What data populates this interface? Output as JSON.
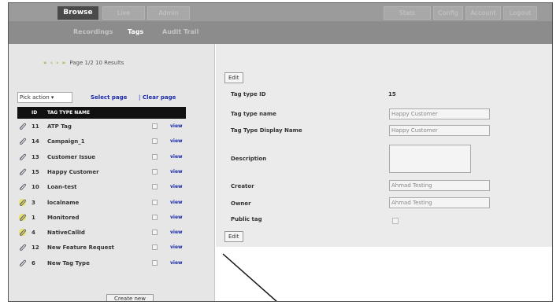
{
  "nav": {
    "tabs_left": [
      {
        "label": "Browse",
        "active": true
      },
      {
        "label": "Live",
        "active": false
      },
      {
        "label": "Admin",
        "active": false
      }
    ],
    "tabs_right": [
      {
        "label": "Stats"
      },
      {
        "label": "Config"
      },
      {
        "label": "Account"
      },
      {
        "label": "Logout"
      }
    ],
    "subtabs": [
      {
        "label": "Recordings",
        "active": false
      },
      {
        "label": "Tags",
        "active": true
      },
      {
        "label": "Audit Trail",
        "active": false
      }
    ]
  },
  "list": {
    "pager": {
      "nav_glyphs": "« ‹ › »",
      "text": "Page 1/2 10 Results"
    },
    "pick_action": "Pick action ▾",
    "select_page": "Select page",
    "separator": "|",
    "clear_page": "Clear page",
    "columns": [
      "ID",
      "TAG TYPE NAME"
    ],
    "rows": [
      {
        "id": "11",
        "name": "ATP Tag",
        "icon": "paperclip-icon",
        "view": "view"
      },
      {
        "id": "14",
        "name": "Campaign_1",
        "icon": "paperclip-icon",
        "view": "view"
      },
      {
        "id": "13",
        "name": "Customer Issue",
        "icon": "paperclip-icon",
        "view": "view"
      },
      {
        "id": "15",
        "name": "Happy Customer",
        "icon": "paperclip-icon",
        "view": "view"
      },
      {
        "id": "10",
        "name": "Loan-test",
        "icon": "paperclip-icon",
        "view": "view"
      },
      {
        "id": "3",
        "name": "localname",
        "icon": "yellow-paperclip-icon",
        "view": "view"
      },
      {
        "id": "1",
        "name": "Monitored",
        "icon": "yellow-paperclip-icon",
        "view": "view"
      },
      {
        "id": "4",
        "name": "NativeCallId",
        "icon": "yellow-paperclip-icon",
        "view": "view"
      },
      {
        "id": "12",
        "name": "New Feature Request",
        "icon": "paperclip-icon",
        "view": "view"
      },
      {
        "id": "6",
        "name": "New Tag Type",
        "icon": "paperclip-icon",
        "view": "view"
      }
    ],
    "create_new": "Create new"
  },
  "detail": {
    "edit_label": "Edit",
    "tag_type_id_label": "Tag type ID",
    "tag_type_id": "15",
    "tag_type_name_label": "Tag type name",
    "tag_type_name": "Happy Customer",
    "display_name_label": "Tag Type Display Name",
    "display_name": "Happy Customer",
    "description_label": "Description",
    "description": "",
    "creator_label": "Creator",
    "creator": "Ahmad Testing",
    "owner_label": "Owner",
    "owner": "Ahmad Testing",
    "public_label": "Public tag",
    "public": false
  },
  "colors": {
    "header": "#9b9b9b",
    "active_tab": "#4a4a4a",
    "link": "#1a2aaa",
    "left_panel": "#e6e6e6",
    "right_panel": "#ebebeb"
  }
}
